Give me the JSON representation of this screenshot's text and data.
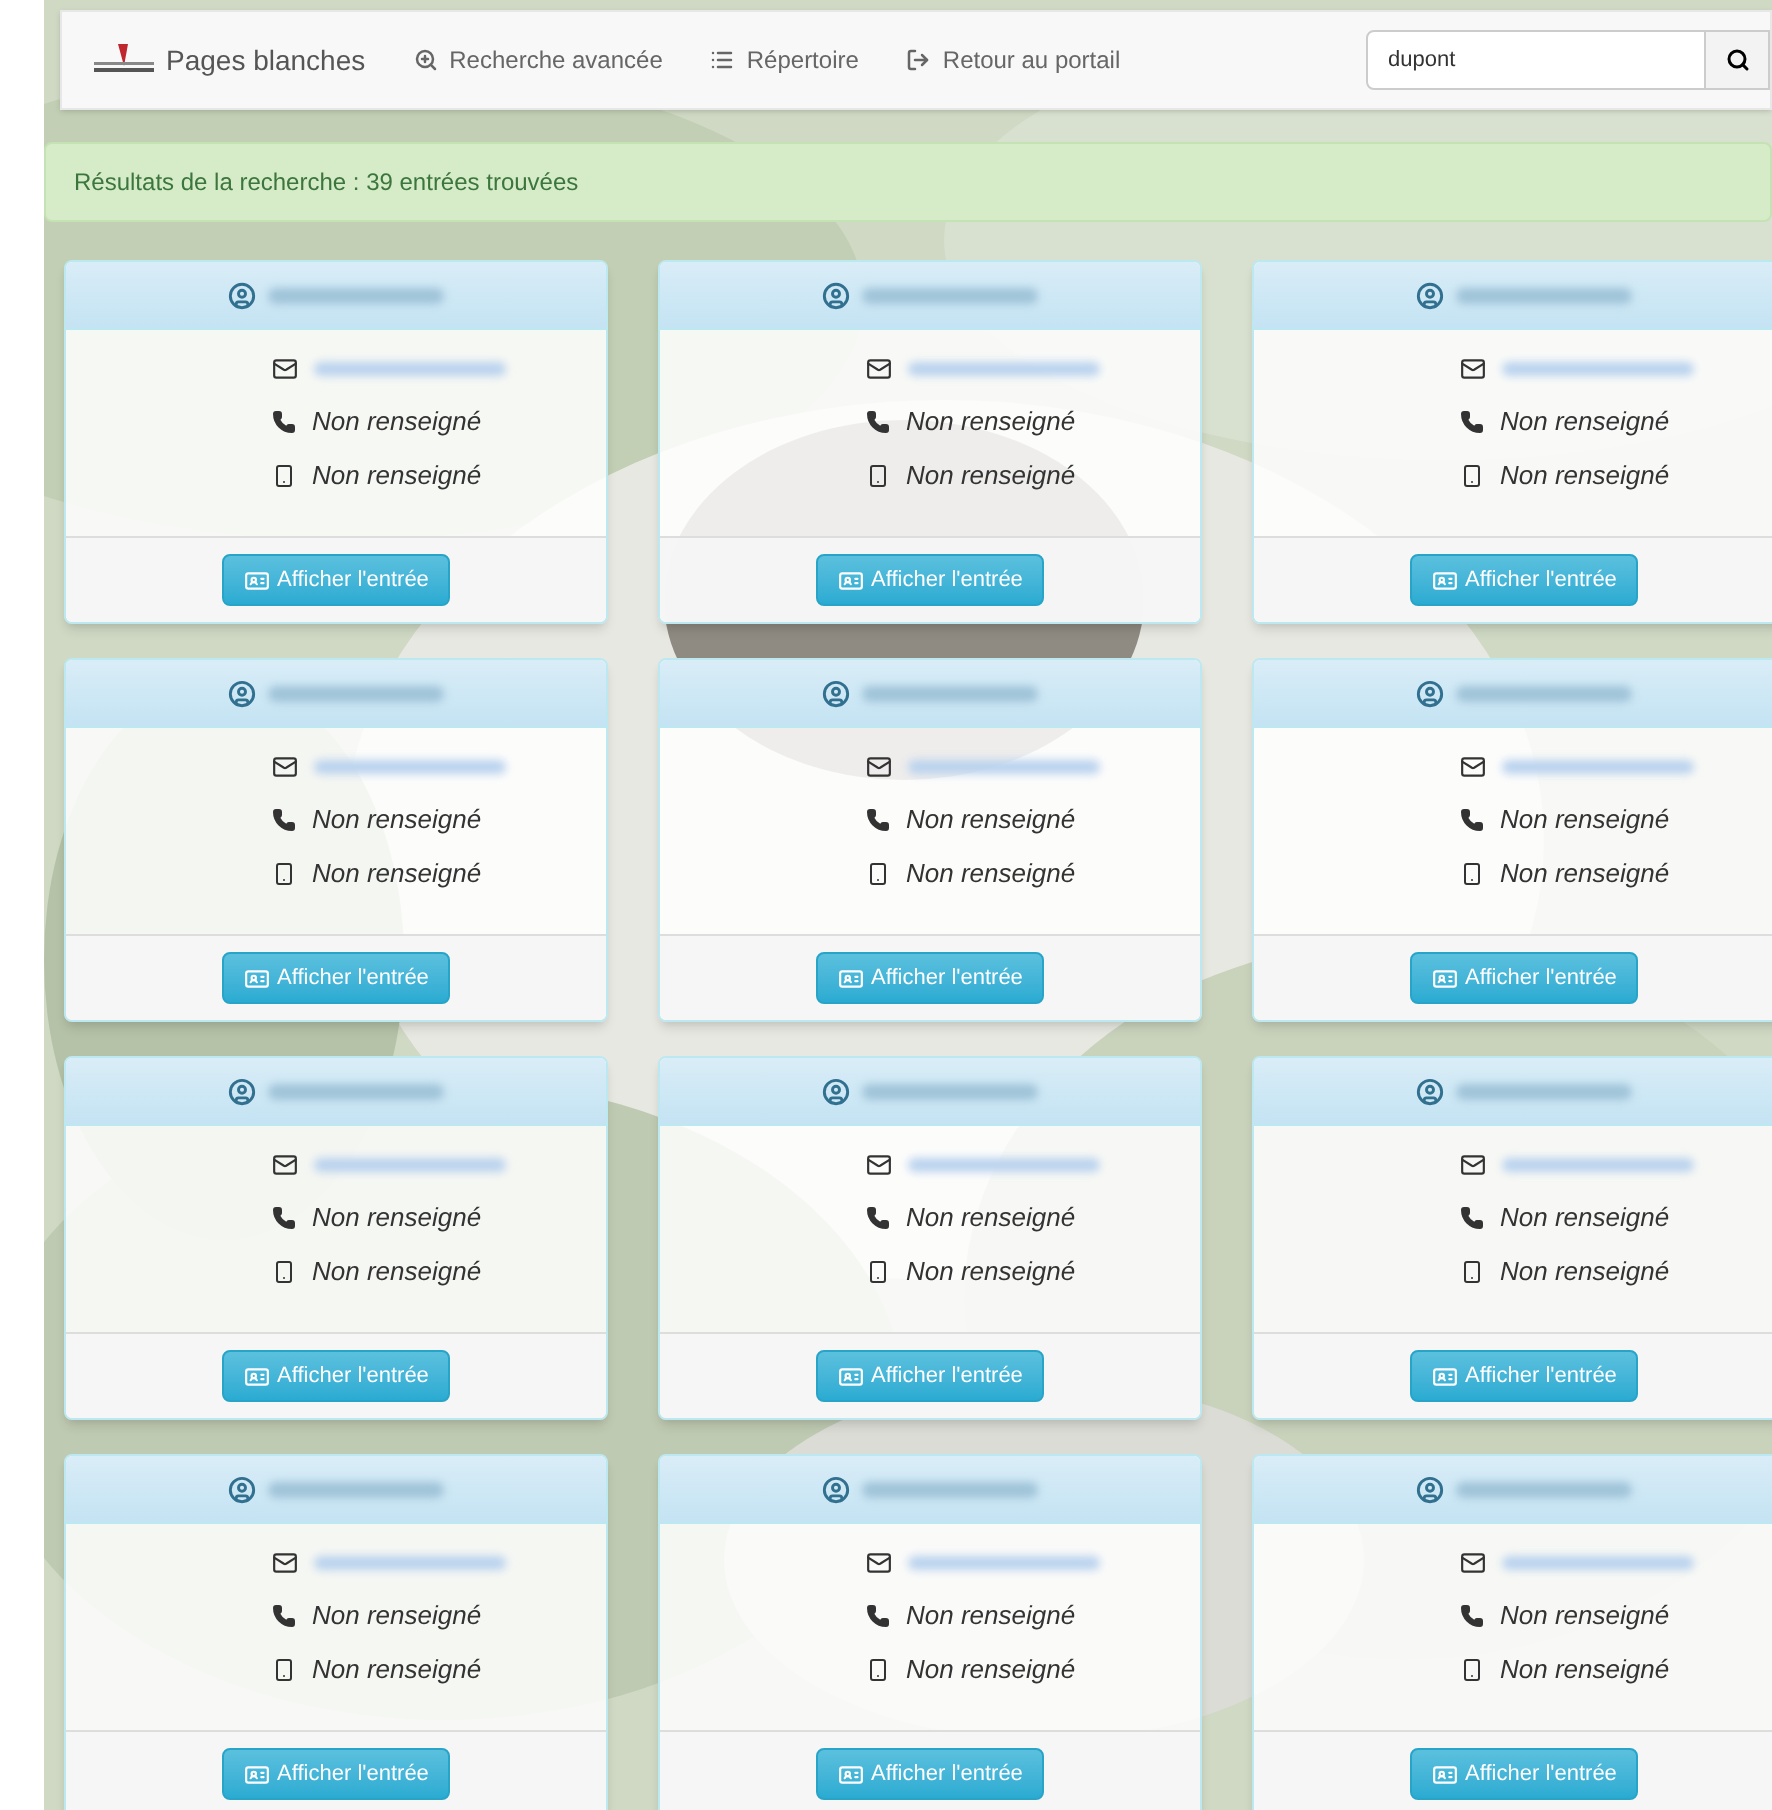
{
  "navbar": {
    "brand": "Pages blanches",
    "links": [
      {
        "kind": "search",
        "label": "Recherche avancée"
      },
      {
        "kind": "list",
        "label": "Répertoire"
      },
      {
        "kind": "exit",
        "label": "Retour au portail"
      }
    ],
    "search": {
      "value": "dupont"
    }
  },
  "alert": {
    "text": "Résultats de la recherche : 39 entrées trouvées"
  },
  "cards": [
    {
      "phone": "Non renseigné",
      "mobile": "Non renseigné",
      "button": "Afficher l'entrée"
    },
    {
      "phone": "Non renseigné",
      "mobile": "Non renseigné",
      "button": "Afficher l'entrée"
    },
    {
      "phone": "Non renseigné",
      "mobile": "Non renseigné",
      "button": "Afficher l'entrée"
    },
    {
      "phone": "Non renseigné",
      "mobile": "Non renseigné",
      "button": "Afficher l'entrée"
    },
    {
      "phone": "Non renseigné",
      "mobile": "Non renseigné",
      "button": "Afficher l'entrée"
    },
    {
      "phone": "Non renseigné",
      "mobile": "Non renseigné",
      "button": "Afficher l'entrée"
    },
    {
      "phone": "Non renseigné",
      "mobile": "Non renseigné",
      "button": "Afficher l'entrée"
    },
    {
      "phone": "Non renseigné",
      "mobile": "Non renseigné",
      "button": "Afficher l'entrée"
    },
    {
      "phone": "Non renseigné",
      "mobile": "Non renseigné",
      "button": "Afficher l'entrée"
    },
    {
      "phone": "Non renseigné",
      "mobile": "Non renseigné",
      "button": "Afficher l'entrée"
    },
    {
      "phone": "Non renseigné",
      "mobile": "Non renseigné",
      "button": "Afficher l'entrée"
    },
    {
      "phone": "Non renseigné",
      "mobile": "Non renseigné",
      "button": "Afficher l'entrée"
    }
  ]
}
